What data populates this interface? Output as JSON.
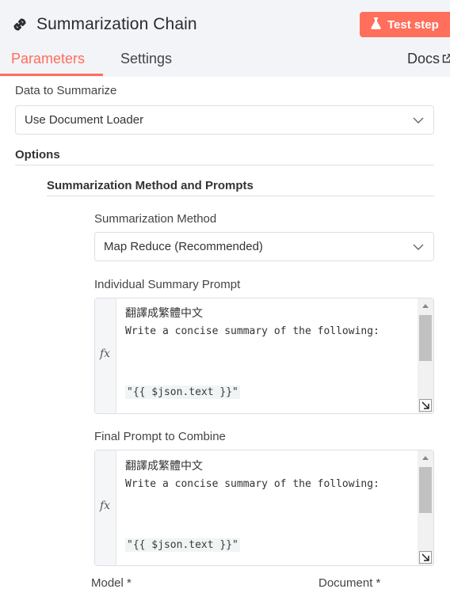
{
  "header": {
    "title": "Summarization Chain",
    "test_step_label": "Test step",
    "tabs": [
      {
        "label": "Parameters",
        "active": true
      },
      {
        "label": "Settings",
        "active": false
      }
    ],
    "docs_label": "Docs",
    "accent_color": "#ff6d5a"
  },
  "fields": {
    "data_to_summarize": {
      "label": "Data to Summarize",
      "value": "Use Document Loader"
    },
    "options_label": "Options",
    "method_section_label": "Summarization Method and Prompts",
    "summarization_method": {
      "label": "Summarization Method",
      "value": "Map Reduce (Recommended)"
    },
    "individual_prompt": {
      "label": "Individual Summary Prompt",
      "fx": "fx",
      "line1": "翻譯成繁體中文",
      "line2": "Write a concise summary of the following:",
      "line3": "\"{{ $json.text }}\""
    },
    "final_prompt": {
      "label": "Final Prompt to Combine",
      "fx": "fx",
      "line1": "翻譯成繁體中文",
      "line2": "Write a concise summary of the following:",
      "line3": "\"{{ $json.text }}\""
    }
  },
  "footer": {
    "model_label": "Model *",
    "document_label": "Document *"
  }
}
